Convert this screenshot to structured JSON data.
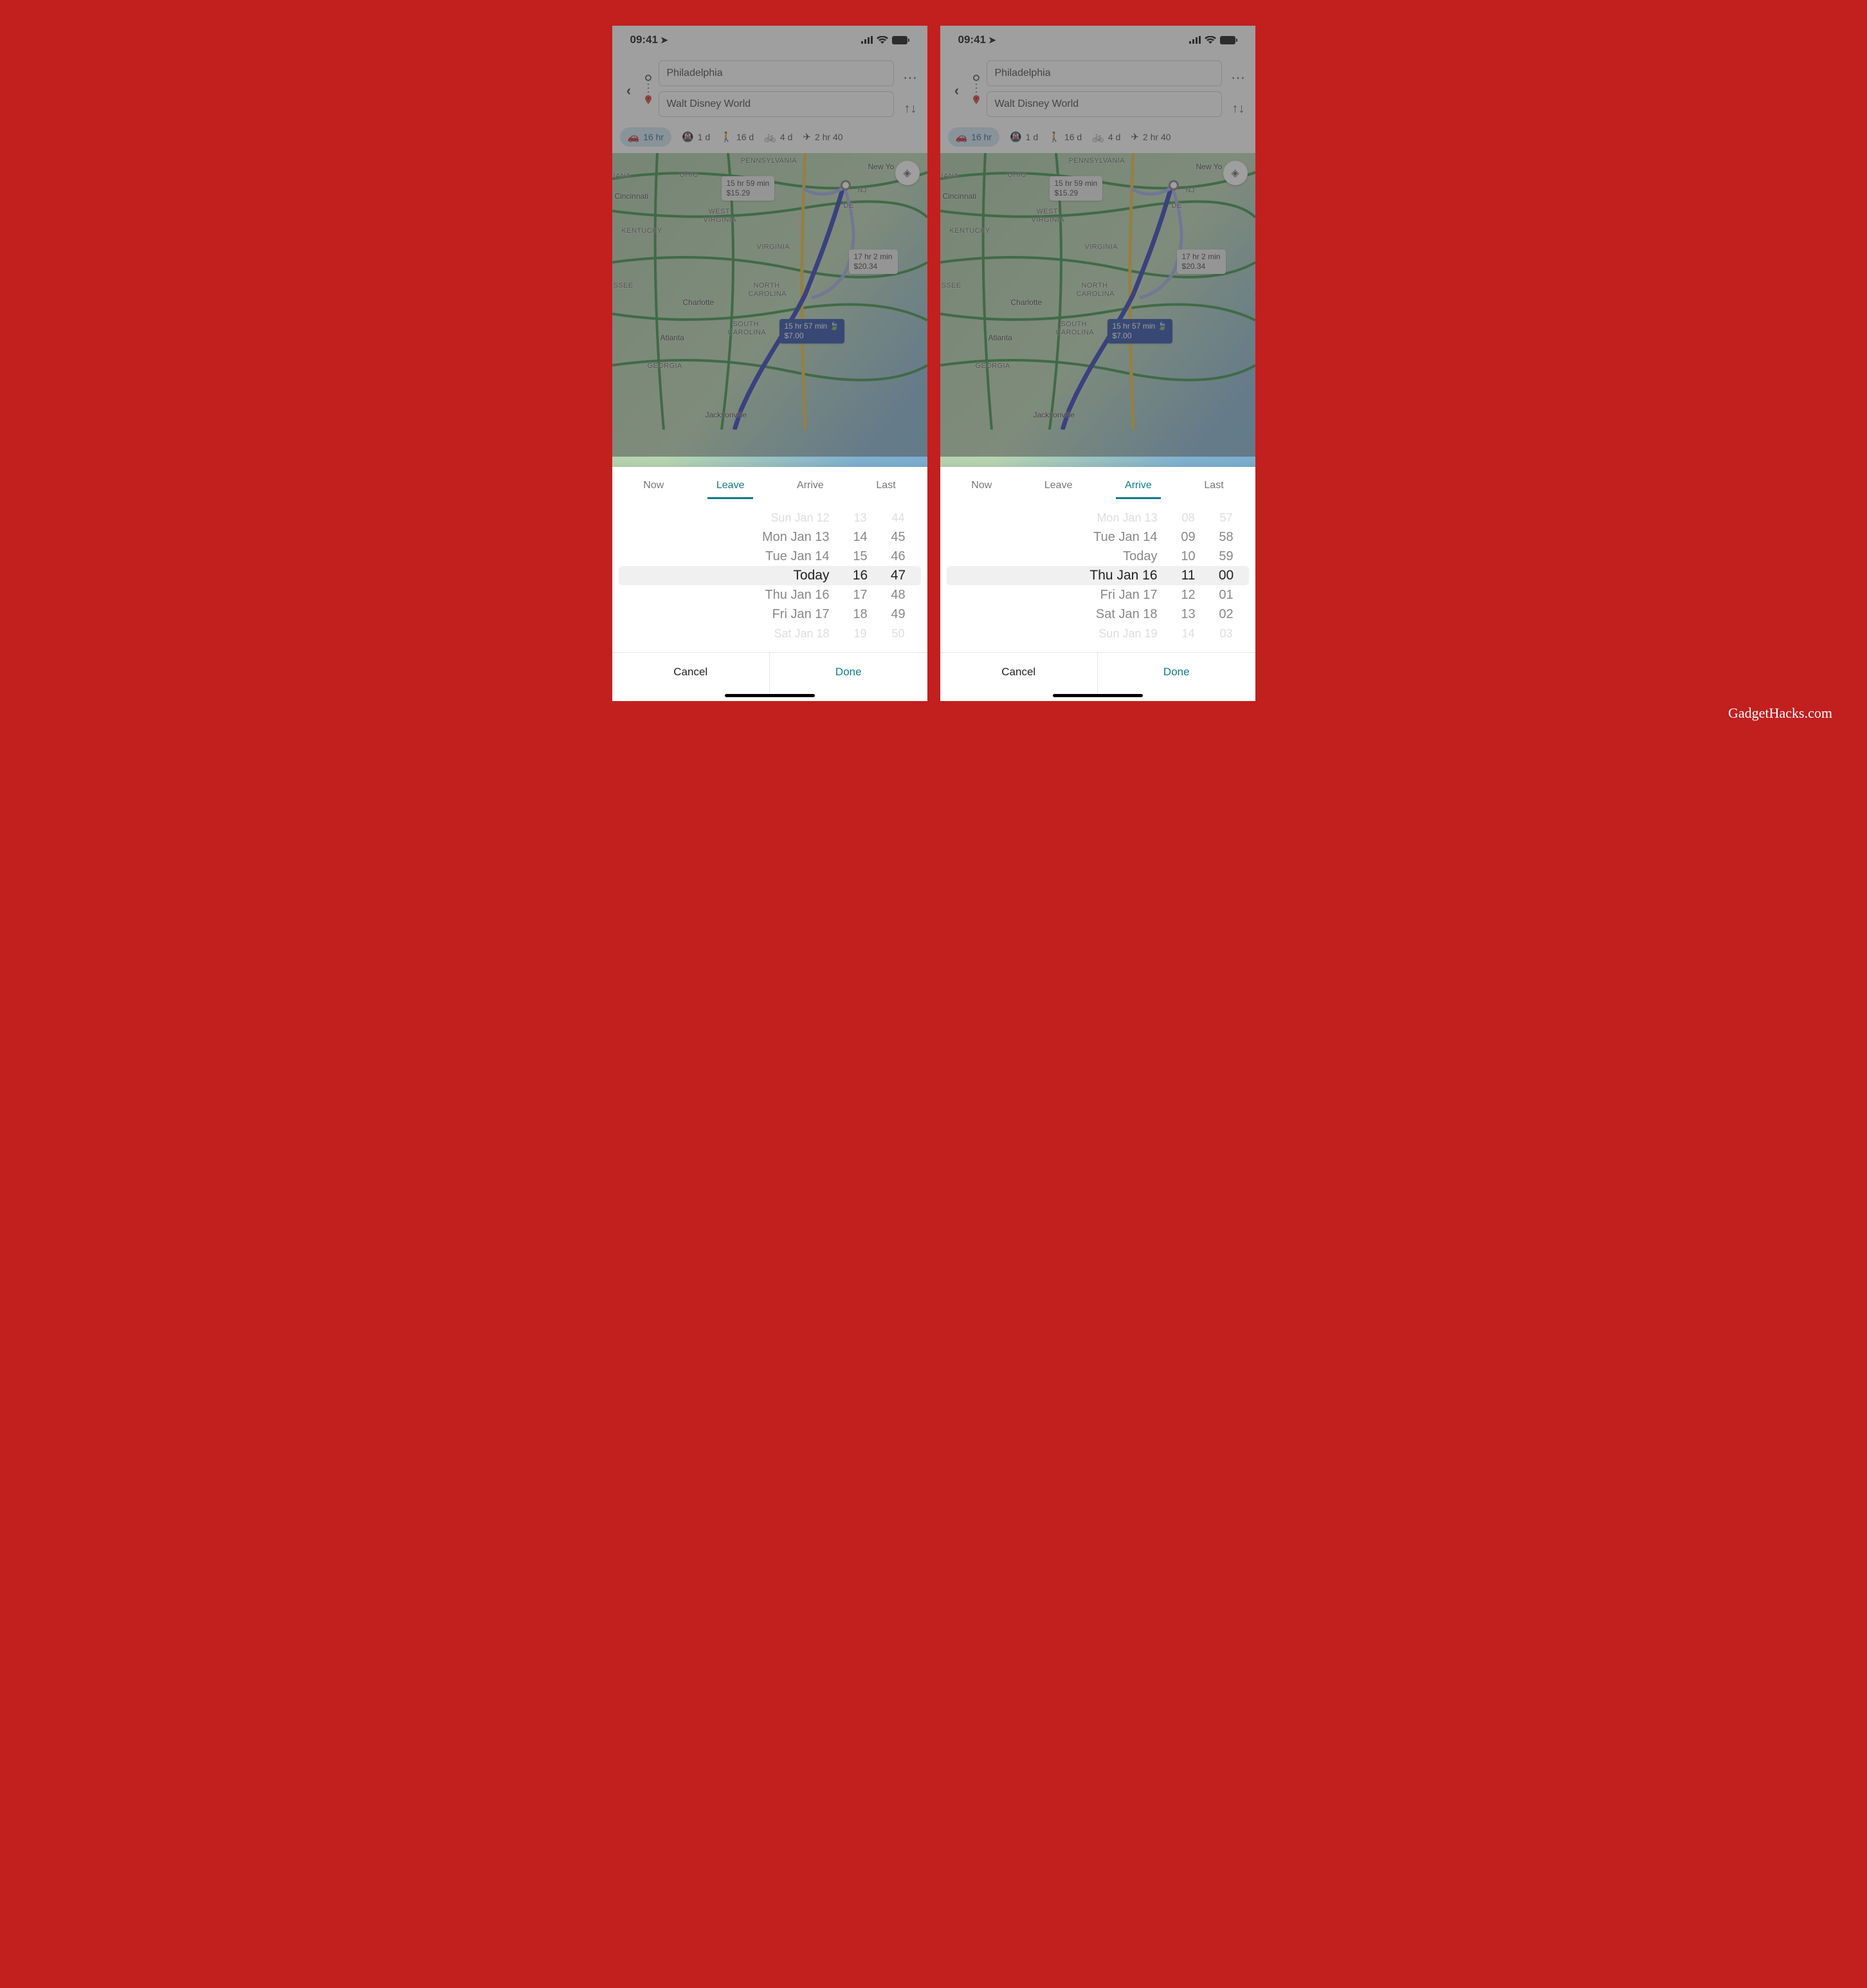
{
  "watermark": "GadgetHacks.com",
  "status": {
    "time": "09:41"
  },
  "directions": {
    "origin": "Philadelphia",
    "destination": "Walt Disney World"
  },
  "modes": {
    "car": {
      "label": "16 hr"
    },
    "transit": {
      "label": "1 d"
    },
    "walk": {
      "label": "16 d"
    },
    "bike": {
      "label": "4 d"
    },
    "plane": {
      "label": "2 hr 40"
    }
  },
  "map": {
    "labels": {
      "pennsylvania": "PENNSYLVANIA",
      "ohio": "OHIO",
      "newyork": "New Yo",
      "nj": "NJ",
      "de": "DE",
      "westvirginia1": "WEST",
      "westvirginia2": "VIRGINIA",
      "virginia": "VIRGINIA",
      "kentucky": "KENTUCKY",
      "cincinnati": "Cincinnati",
      "iana": "IANA",
      "ssee": "SSEE",
      "northcarolina1": "NORTH",
      "northcarolina2": "CAROLINA",
      "charlotte": "Charlotte",
      "southcarolina1": "SOUTH",
      "southcarolina2": "CAROLINA",
      "atlanta": "Atlanta",
      "georgia": "GEORGIA",
      "jacksonville": "Jacksonville"
    },
    "callouts": {
      "a": {
        "t": "15 hr 59 min",
        "p": "$15.29"
      },
      "b": {
        "t": "17 hr 2 min",
        "p": "$20.34"
      },
      "c": {
        "t": "15 hr 57 min",
        "p": "$7.00"
      }
    }
  },
  "sheetLabels": {
    "now": "Now",
    "leave": "Leave",
    "arrive": "Arrive",
    "last": "Last",
    "cancel": "Cancel",
    "done": "Done"
  },
  "pickerLeft": {
    "dates": [
      "Sun Jan 12",
      "Mon Jan 13",
      "Tue Jan 14",
      "Today",
      "Thu Jan 16",
      "Fri Jan 17",
      "Sat Jan 18"
    ],
    "hours": [
      "13",
      "14",
      "15",
      "16",
      "17",
      "18",
      "19"
    ],
    "mins": [
      "44",
      "45",
      "46",
      "47",
      "48",
      "49",
      "50"
    ]
  },
  "pickerRight": {
    "dates": [
      "Mon Jan 13",
      "Tue Jan 14",
      "Today",
      "Thu Jan 16",
      "Fri Jan 17",
      "Sat Jan 18",
      "Sun Jan 19"
    ],
    "hours": [
      "08",
      "09",
      "10",
      "11",
      "12",
      "13",
      "14"
    ],
    "mins": [
      "57",
      "58",
      "59",
      "00",
      "01",
      "02",
      "03"
    ]
  }
}
